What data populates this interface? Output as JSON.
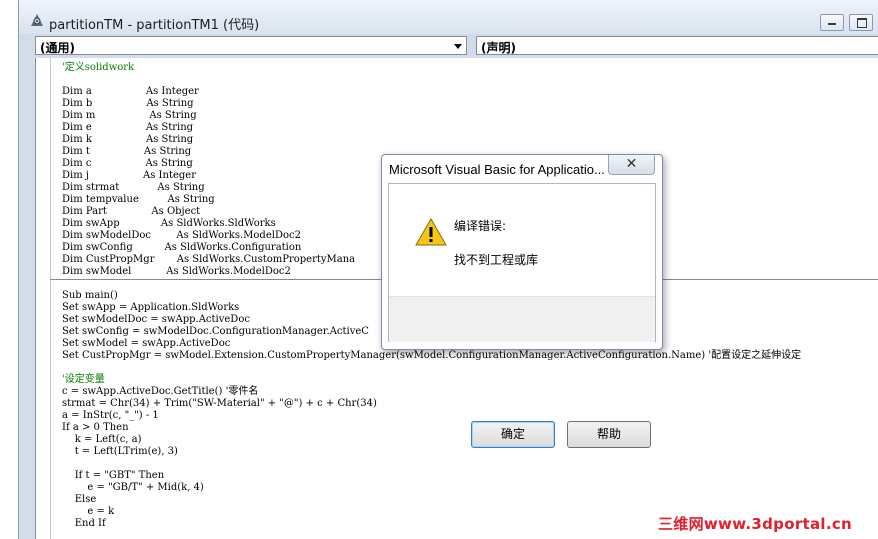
{
  "window": {
    "title": "partitionTM - partitionTM1 (代码)",
    "object_combo": "(通用)",
    "proc_combo": "(声明)"
  },
  "code_lines": [
    {
      "t": "'定义solidwork",
      "c": "cm"
    },
    {
      "t": "",
      "c": ""
    },
    {
      "t": "Dim a                 As Integer",
      "c": "kw"
    },
    {
      "t": "Dim b                 As String",
      "c": "kw"
    },
    {
      "t": "Dim m                 As String",
      "c": "kw"
    },
    {
      "t": "Dim e                 As String",
      "c": "kw"
    },
    {
      "t": "Dim k                 As String",
      "c": "kw"
    },
    {
      "t": "Dim t                 As String",
      "c": "kw"
    },
    {
      "t": "Dim c                 As String",
      "c": "kw"
    },
    {
      "t": "Dim j                 As Integer",
      "c": "kw"
    },
    {
      "t": "Dim strmat            As String",
      "c": "kw"
    },
    {
      "t": "Dim tempvalue         As String",
      "c": "kw"
    },
    {
      "t": "Dim Part              As Object",
      "c": "kw"
    },
    {
      "t": "Dim swApp             As SldWorks.SldWorks",
      "c": "kw"
    },
    {
      "t": "Dim swModelDoc        As SldWorks.ModelDoc2",
      "c": "kw"
    },
    {
      "t": "Dim swConfig          As SldWorks.Configuration",
      "c": "kw"
    },
    {
      "t": "Dim CustPropMgr       As SldWorks.CustomPropertyMana",
      "c": "kw"
    },
    {
      "t": "Dim swModel           As SldWorks.ModelDoc2",
      "c": "kw"
    },
    {
      "t": "",
      "c": "sepgap"
    },
    {
      "t": "Sub main()",
      "c": "kw"
    },
    {
      "t": "Set swApp = Application.SldWorks",
      "c": "kw"
    },
    {
      "t": "Set swModelDoc = swApp.ActiveDoc",
      "c": "kw"
    },
    {
      "t": "Set swConfig = swModelDoc.ConfigurationManager.ActiveC",
      "c": "kw"
    },
    {
      "t": "Set swModel = swApp.ActiveDoc",
      "c": "kw"
    },
    {
      "t": "Set CustPropMgr = swModel.Extension.CustomPropertyManager(swModel.ConfigurationManager.ActiveConfiguration.Name) '配置设定之延伸设定",
      "c": "kw"
    },
    {
      "t": "",
      "c": ""
    },
    {
      "t": "'设定变量",
      "c": "cm"
    },
    {
      "t": "c = swApp.ActiveDoc.GetTitle() '零件名",
      "c": "kw"
    },
    {
      "t": "strmat = Chr(34) + Trim(\"SW-Material\" + \"@\") + c + Chr(34)",
      "c": "kw"
    },
    {
      "t": "a = InStr(c, \"_\") - 1",
      "c": "kw"
    },
    {
      "t": "If a > 0 Then",
      "c": "kw"
    },
    {
      "t": "    k = Left(c, a)",
      "c": "kw"
    },
    {
      "t": "    t = Left(LTrim(e), 3)",
      "c": "kw"
    },
    {
      "t": "",
      "c": ""
    },
    {
      "t": "    If t = \"GBT\" Then",
      "c": "kw"
    },
    {
      "t": "        e = \"GB/T\" + Mid(k, 4)",
      "c": "kw"
    },
    {
      "t": "    Else",
      "c": "kw"
    },
    {
      "t": "        e = k",
      "c": "kw"
    },
    {
      "t": "    End If",
      "c": "kw"
    }
  ],
  "dialog": {
    "title": "Microsoft Visual Basic for Applicatio...",
    "close_glyph": "✕",
    "message_1": "编译错误:",
    "message_2": "找不到工程或库",
    "ok_label": "确定",
    "help_label": "帮助",
    "icon": "warning-icon"
  },
  "watermark": "三维网www.3dportal.cn",
  "colors": {
    "keyword": "#00007f",
    "comment": "#007f00",
    "watermark": "#e0202a"
  }
}
